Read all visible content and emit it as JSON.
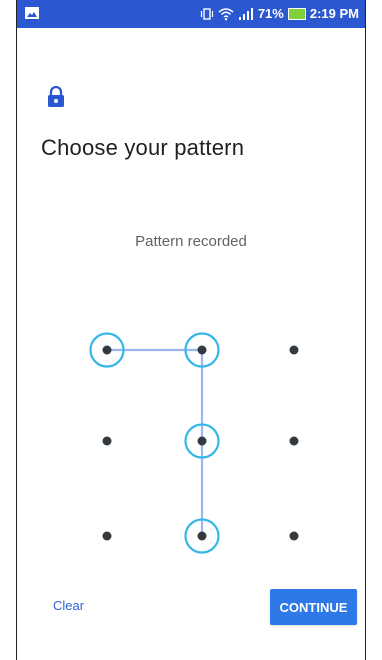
{
  "status_bar": {
    "battery": "71%",
    "time": "2:19 PM",
    "icons": [
      "image-icon",
      "vibrate-icon",
      "wifi-icon",
      "signal-icon",
      "battery-icon"
    ]
  },
  "screen": {
    "lock_icon": "lock-icon",
    "title": "Choose your pattern",
    "subtitle": "Pattern recorded"
  },
  "pattern": {
    "grid_rows": 3,
    "grid_cols": 3,
    "selected_sequence": [
      "top-left",
      "top-middle",
      "middle-middle",
      "bottom-middle"
    ],
    "colors": {
      "dot": "#333a40",
      "selected_ring": "#35b6e8",
      "line": "#9db4ef"
    }
  },
  "footer": {
    "clear_label": "Clear",
    "continue_label": "CONTINUE"
  },
  "colors": {
    "status_bar": "#2b58d0",
    "accent": "#2f64d6",
    "continue_button": "#2f78e8",
    "battery_fill": "#7fd13b"
  }
}
